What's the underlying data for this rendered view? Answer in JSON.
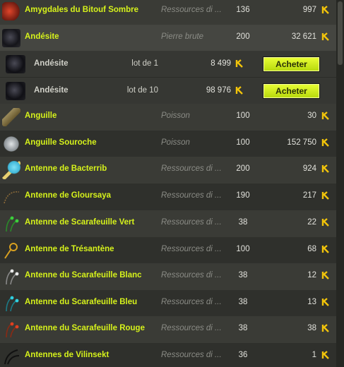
{
  "rows": [
    {
      "name": "Amygdales du Bitouf Sombre",
      "category": "Ressources di ...",
      "level": "136",
      "price": "997",
      "icon": "red-claw-icon",
      "icon_color": "#c23a24"
    },
    {
      "name": "Andésite",
      "category": "Pierre brute",
      "level": "200",
      "price": "32 621",
      "icon": "dark-stone-icon",
      "icon_color": "#1d1d22"
    },
    {
      "name": "Andésite",
      "lot": "lot de 1",
      "price": "8 499",
      "button": "Acheter",
      "icon": "dark-stone-icon",
      "icon_color": "#1d1d22"
    },
    {
      "name": "Andésite",
      "lot": "lot de 10",
      "price": "98 976",
      "button": "Acheter",
      "icon": "dark-stone-icon",
      "icon_color": "#1d1d22"
    },
    {
      "name": "Anguille",
      "category": "Poisson",
      "level": "100",
      "price": "30",
      "icon": "eel-icon",
      "icon_color": "#9a8a5a"
    },
    {
      "name": "Anguille Souroche",
      "category": "Poisson",
      "level": "100",
      "price": "152 750",
      "icon": "grey-eel-icon",
      "icon_color": "#c8cccf"
    },
    {
      "name": "Antenne de Bacterrib",
      "category": "Ressources di ...",
      "level": "200",
      "price": "924",
      "icon": "antenna-icon",
      "icon_color": "#3fb6d8"
    },
    {
      "name": "Antenne de Gloursaya",
      "category": "Ressources di ...",
      "level": "190",
      "price": "217",
      "icon": "thin-antenna-icon",
      "icon_color": "#8a6a3a"
    },
    {
      "name": "Antenne de Scarafeuille Vert",
      "category": "Ressources di ...",
      "level": "38",
      "price": "22",
      "icon": "green-antenna-icon",
      "icon_color": "#3cd03c"
    },
    {
      "name": "Antenne de Trésantène",
      "category": "Ressources di ...",
      "level": "100",
      "price": "68",
      "icon": "gold-antenna-icon",
      "icon_color": "#d8a020"
    },
    {
      "name": "Antenne du Scarafeuille Blanc",
      "category": "Ressources di ...",
      "level": "38",
      "price": "12",
      "icon": "white-antenna-icon",
      "icon_color": "#e8e8e8"
    },
    {
      "name": "Antenne du Scarafeuille Bleu",
      "category": "Ressources di ...",
      "level": "38",
      "price": "13",
      "icon": "blue-antenna-icon",
      "icon_color": "#30d0e0"
    },
    {
      "name": "Antenne du Scarafeuille Rouge",
      "category": "Ressources di ...",
      "level": "38",
      "price": "38",
      "icon": "red-antenna-icon",
      "icon_color": "#e04020"
    },
    {
      "name": "Antennes de Vilinsekt",
      "category": "Ressources di ...",
      "level": "36",
      "price": "1",
      "icon": "black-antenna-icon",
      "icon_color": "#222"
    }
  ],
  "currency_icon": "kama-icon",
  "accent": "#d6f21b"
}
